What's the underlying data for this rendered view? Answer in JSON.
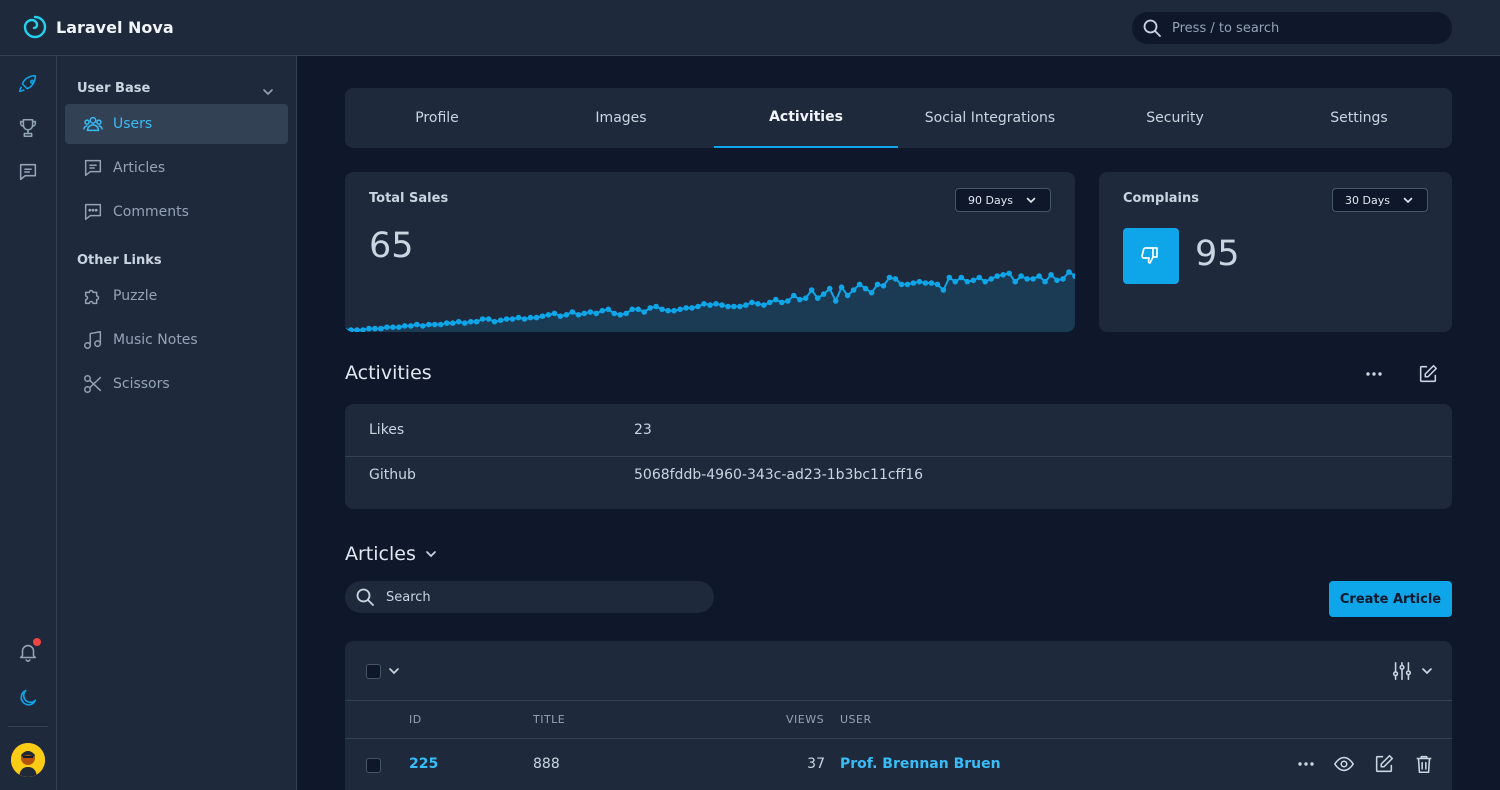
{
  "app": {
    "name": "Laravel Nova",
    "accent": "#0ea5e9"
  },
  "search": {
    "placeholder": "Press / to search"
  },
  "sidebar": {
    "sections": [
      {
        "title": "User Base",
        "items": [
          {
            "label": "Users",
            "icon": "users-icon",
            "active": true
          },
          {
            "label": "Articles",
            "icon": "article-icon"
          },
          {
            "label": "Comments",
            "icon": "comment-icon"
          }
        ]
      },
      {
        "title": "Other Links",
        "items": [
          {
            "label": "Puzzle",
            "icon": "puzzle-icon"
          },
          {
            "label": "Music Notes",
            "icon": "music-icon"
          },
          {
            "label": "Scissors",
            "icon": "scissors-icon"
          }
        ]
      }
    ]
  },
  "tabs": [
    {
      "label": "Profile"
    },
    {
      "label": "Images"
    },
    {
      "label": "Activities",
      "active": true
    },
    {
      "label": "Social Integrations"
    },
    {
      "label": "Security"
    },
    {
      "label": "Settings"
    }
  ],
  "metrics": {
    "total_sales": {
      "title": "Total Sales",
      "value": "65",
      "range": "90 Days"
    },
    "complains": {
      "title": "Complains",
      "value": "95",
      "range": "30 Days"
    }
  },
  "chart_data": {
    "type": "line",
    "title": "",
    "values": [
      0,
      0,
      0,
      0,
      1,
      1,
      1,
      2,
      2,
      2,
      3,
      3,
      4,
      3,
      4,
      4,
      4,
      5,
      5,
      6,
      5,
      6,
      6,
      8,
      8,
      6,
      7,
      8,
      8,
      9,
      8,
      9,
      9,
      10,
      11,
      12,
      10,
      11,
      13,
      11,
      12,
      13,
      12,
      14,
      15,
      12,
      11,
      12,
      15,
      15,
      13,
      16,
      17,
      15,
      14,
      14,
      15,
      16,
      16,
      17,
      19,
      18,
      19,
      18,
      17,
      17,
      17,
      18,
      20,
      19,
      18,
      20,
      22,
      20,
      21,
      25,
      22,
      23,
      29,
      23,
      26,
      30,
      21,
      31,
      25,
      29,
      33,
      30,
      27,
      33,
      32,
      38,
      37,
      33,
      33,
      34,
      35,
      34,
      34,
      33,
      29,
      38,
      35,
      38,
      35,
      36,
      38,
      35,
      37,
      39,
      40,
      41,
      35,
      39,
      37,
      37,
      39,
      35,
      40,
      36,
      37,
      42,
      39
    ],
    "color": "#0ea5e9"
  },
  "activities": {
    "title": "Activities",
    "rows": [
      {
        "key": "Likes",
        "value": "23"
      },
      {
        "key": "Github",
        "value": "5068fddb-4960-343c-ad23-1b3bc11cff16"
      }
    ]
  },
  "articles": {
    "title": "Articles",
    "search_placeholder": "Search",
    "create_label": "Create Article",
    "columns": {
      "id": "ID",
      "title": "TITLE",
      "views": "VIEWS",
      "user": "USER"
    },
    "rows": [
      {
        "id": "225",
        "title": "888",
        "views": "37",
        "user": "Prof. Brennan Bruen"
      }
    ]
  }
}
